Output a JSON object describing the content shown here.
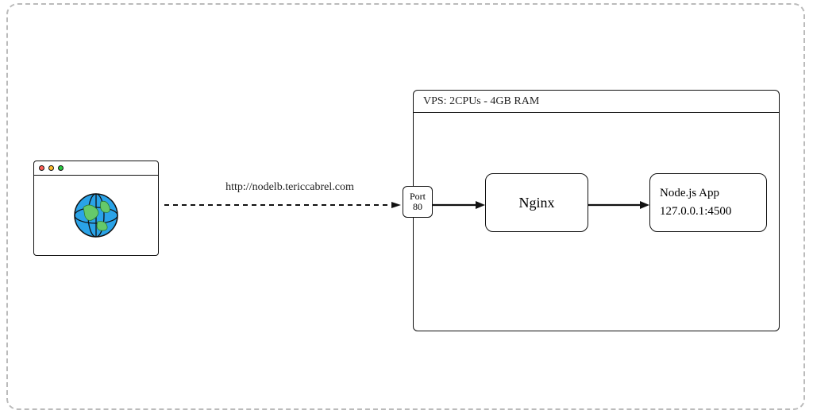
{
  "browser": {
    "icon": "globe-icon"
  },
  "connection": {
    "url": "http://nodelb.tericcabrel.com"
  },
  "vps": {
    "title": "VPS: 2CPUs - 4GB RAM"
  },
  "port": {
    "label": "Port",
    "value": "80"
  },
  "nginx": {
    "label": "Nginx"
  },
  "nodeapp": {
    "title": "Node.js App",
    "address": "127.0.0.1:4500"
  }
}
